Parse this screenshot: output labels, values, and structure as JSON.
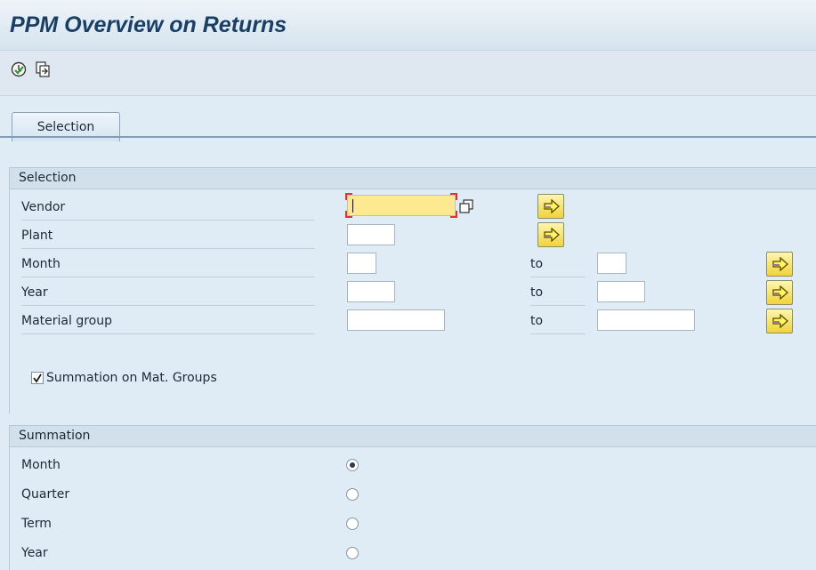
{
  "window": {
    "title": "PPM Overview on Returns"
  },
  "toolbar": {
    "execute_icon": "execute-clock-icon",
    "variant_icon": "get-variant-icon"
  },
  "tabs": [
    {
      "label": "Selection"
    }
  ],
  "selection_group": {
    "title": "Selection",
    "fields": [
      {
        "label": "Vendor",
        "value": "",
        "has_range": false
      },
      {
        "label": "Plant",
        "value": "",
        "has_range": false
      },
      {
        "label": "Month",
        "value": "",
        "to_label": "to",
        "to_value": ""
      },
      {
        "label": "Year",
        "value": "",
        "to_label": "to",
        "to_value": ""
      },
      {
        "label": "Material group",
        "value": "",
        "to_label": "to",
        "to_value": ""
      }
    ],
    "summation_checkbox": {
      "label": "Summation on Mat. Groups",
      "checked": true
    }
  },
  "summation_group": {
    "title": "Summation",
    "options": [
      {
        "label": "Month",
        "selected": true
      },
      {
        "label": "Quarter",
        "selected": false
      },
      {
        "label": "Term",
        "selected": false
      },
      {
        "label": "Year",
        "selected": false
      }
    ]
  },
  "colors": {
    "background": "#dfebf5",
    "title": "#1a3f66",
    "active_input": "#fde98f",
    "arrow_button": "#f1d33a"
  }
}
